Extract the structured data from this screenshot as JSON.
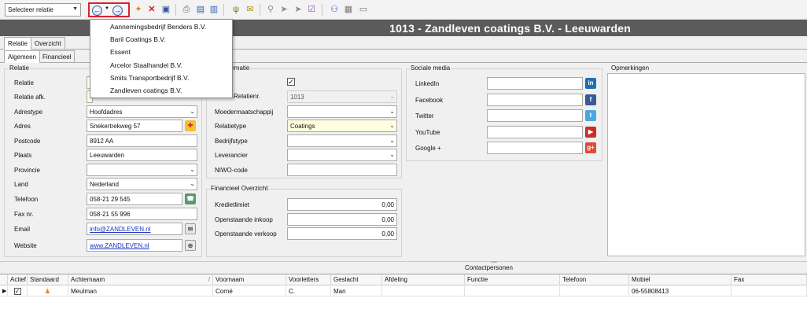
{
  "toolbar": {
    "relation_select": "Selecteer relatie"
  },
  "header": {
    "title": "1013 - Zandleven coatings B.V. - Leeuwarden"
  },
  "tabs_top": [
    "Relatie",
    "Overzicht"
  ],
  "tabs_sub": [
    "Algemeen",
    "Financieel"
  ],
  "recent_menu": {
    "items": [
      "Aannemingsbedrijf Benders B.V.",
      "Baril Coatings B.V.",
      "Essent",
      "Arcelor Staalhandel B.V.",
      "Smits Transportbedrijf B.V.",
      "Zandleven coatings B.V."
    ]
  },
  "relatie": {
    "group_title": "Relatie",
    "labels": {
      "relatie": "Relatie",
      "relatie_afk": "Relatie afk.",
      "adrestype": "Adrestype",
      "adres": "Adres",
      "postcode": "Postcode",
      "plaats": "Plaats",
      "provincie": "Provincie",
      "land": "Land",
      "telefoon": "Telefoon",
      "fax": "Fax nr.",
      "email": "Email",
      "website": "Website"
    },
    "values": {
      "adrestype": "Hoofdadres",
      "adres": "Snekertrekweg 57",
      "postcode": "8912 AA",
      "plaats": "Leeuwarden",
      "provincie": "",
      "land": "Nederland",
      "telefoon": "058-21 29 545",
      "fax": "058-21 55 996",
      "email": "info@ZANDLEVEN.nl",
      "website": "www.ZANDLEVEN.nl"
    }
  },
  "informatie": {
    "group_title_visible": "nformatie",
    "labels": {
      "relatienr": "Relatienr.",
      "moedermaatschappij": "Moedermaatschappij",
      "relatietype": "Relatietype",
      "bedrijfstype": "Bedrijfstype",
      "leverancier": "Leverancier",
      "niwo": "NIWO-code"
    },
    "values": {
      "relatienr": "1013",
      "moedermaatschappij": "",
      "relatietype": "Coatings",
      "bedrijfstype": "",
      "leverancier": "",
      "niwo": ""
    },
    "checked": true
  },
  "financieel": {
    "group_title": "Financieel Overzicht",
    "labels": {
      "kredietlimiet": "Kredietlimiet",
      "inkoop": "Openstaande inkoop",
      "verkoop": "Openstaande verkoop"
    },
    "values": {
      "kredietlimiet": "0,00",
      "inkoop": "0,00",
      "verkoop": "0,00"
    }
  },
  "social": {
    "group_title": "Sociale media",
    "items": [
      {
        "label": "LinkedIn",
        "icon": "linkedin-icon",
        "color": "#1f6fb5",
        "glyph": "in"
      },
      {
        "label": "Facebook",
        "icon": "facebook-icon",
        "color": "#3b5998",
        "glyph": "f"
      },
      {
        "label": "Twitter",
        "icon": "twitter-icon",
        "color": "#4aa8e0",
        "glyph": "t"
      },
      {
        "label": "YouTube",
        "icon": "youtube-icon",
        "color": "#c4302b",
        "glyph": "▶"
      },
      {
        "label": "Google +",
        "icon": "googleplus-icon",
        "color": "#dd4b39",
        "glyph": "g+"
      }
    ]
  },
  "opmerkingen": {
    "group_title": "Opmerkingen",
    "text": ""
  },
  "contacts": {
    "title": "Contactpersonen",
    "columns": [
      "Actief",
      "Standaard",
      "Achternaam",
      "Voornaam",
      "Voorletters",
      "Geslacht",
      "Afdeling",
      "Functie",
      "Telefoon",
      "Mobiel",
      "Fax"
    ],
    "rows": [
      {
        "achternaam": "Meulman",
        "voornaam": "Corné",
        "voorletters": "C.",
        "geslacht": "Man",
        "afdeling": "",
        "functie": "",
        "telefoon": "",
        "mobiel": "06-55808413",
        "fax": ""
      }
    ]
  },
  "colors": {
    "header_bg": "#5b5b5b",
    "highlight_border": "#e0212a",
    "yellow_field": "#ffffdf",
    "link": "#1a33c0"
  }
}
